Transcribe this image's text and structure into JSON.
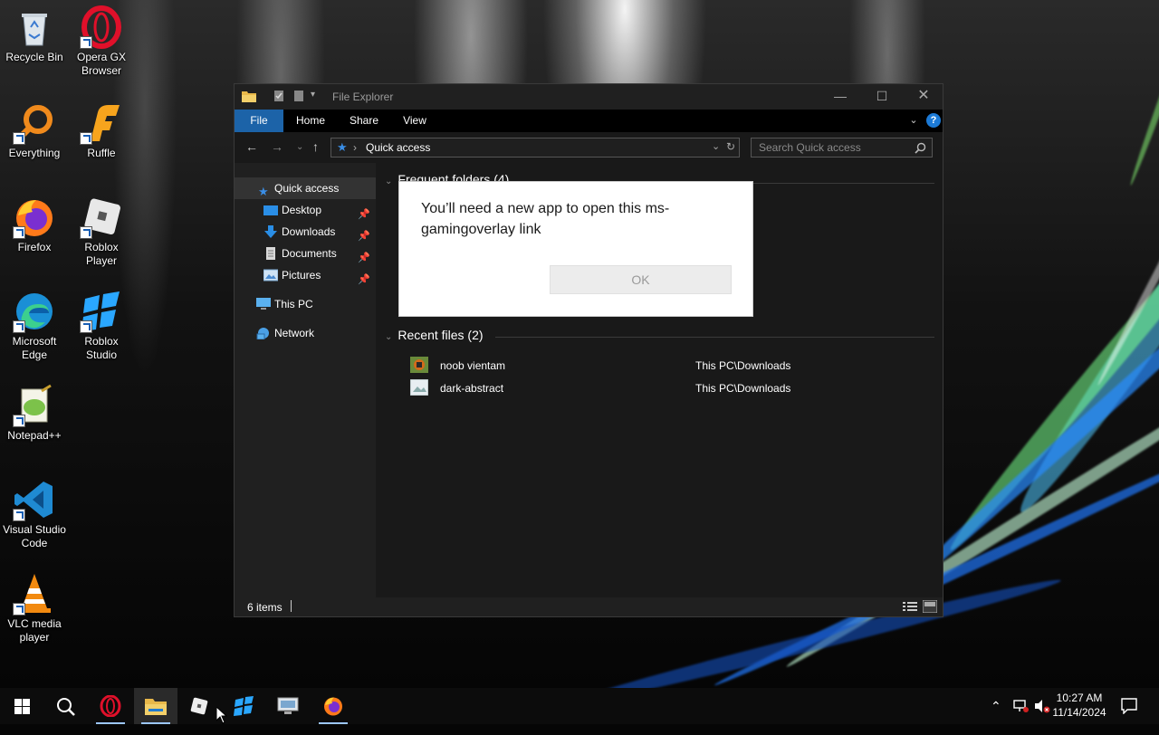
{
  "desktop": {
    "icons": [
      {
        "name": "recycle-bin",
        "label": "Recycle Bin"
      },
      {
        "name": "opera-gx",
        "label": "Opera GX\nBrowser"
      },
      {
        "name": "everything",
        "label": "Everything"
      },
      {
        "name": "ruffle",
        "label": "Ruffle"
      },
      {
        "name": "firefox",
        "label": "Firefox"
      },
      {
        "name": "roblox-player",
        "label": "Roblox\nPlayer"
      },
      {
        "name": "microsoft-edge",
        "label": "Microsoft\nEdge"
      },
      {
        "name": "roblox-studio",
        "label": "Roblox\nStudio"
      },
      {
        "name": "notepad-plus-plus",
        "label": "Notepad++"
      },
      {
        "name": "vscode",
        "label": "Visual Studio\nCode"
      },
      {
        "name": "vlc",
        "label": "VLC media\nplayer"
      }
    ]
  },
  "explorer": {
    "title": "File Explorer",
    "tabs": {
      "file": "File",
      "home": "Home",
      "share": "Share",
      "view": "View"
    },
    "address": {
      "separator": "›",
      "path": "Quick access"
    },
    "search": {
      "placeholder": "Search Quick access"
    },
    "nav": {
      "quick_access": "Quick access",
      "desktop": "Desktop",
      "downloads": "Downloads",
      "documents": "Documents",
      "pictures": "Pictures",
      "this_pc": "This PC",
      "network": "Network"
    },
    "frequent_folders": "Frequent folders (4)",
    "recent_files_header": "Recent files (2)",
    "recent_files": [
      {
        "name": "noob vientam",
        "path": "This PC\\Downloads"
      },
      {
        "name": "dark-abstract",
        "path": "This PC\\Downloads"
      }
    ],
    "status": {
      "items": "6 items"
    }
  },
  "dialog": {
    "message": "You’ll need a new app to open this ms-gamingoverlay link",
    "ok": "OK"
  },
  "taskbar": {
    "clock_time": "10:27 AM",
    "clock_date": "11/14/2024"
  },
  "colors": {
    "accent": "#1c63a8",
    "taskbar": "#0c0c0c",
    "explorer_bg": "#191919"
  }
}
